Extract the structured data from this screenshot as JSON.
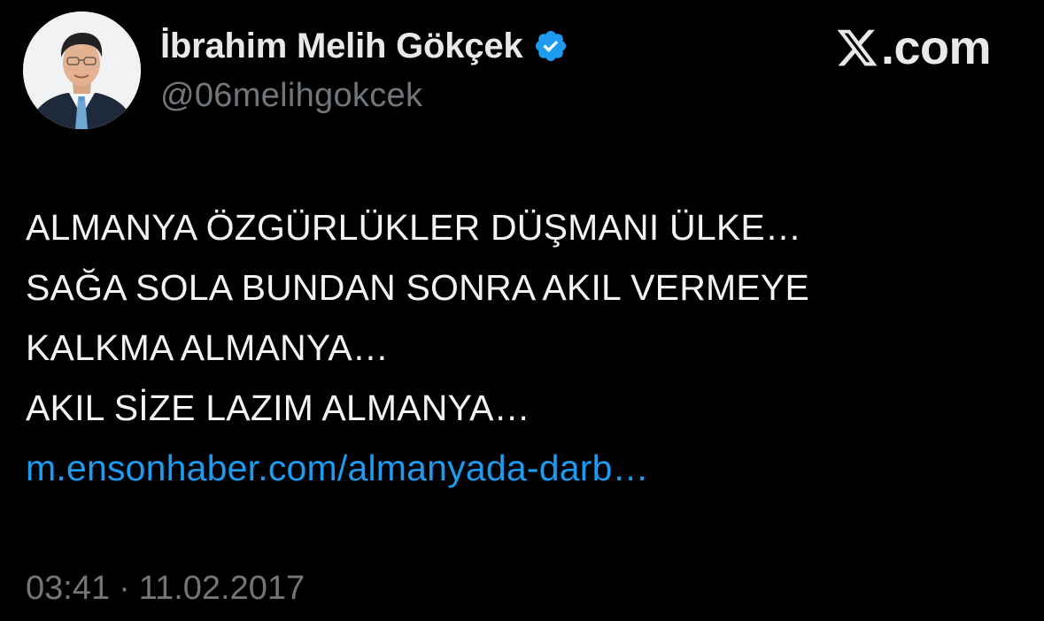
{
  "author": {
    "display_name": "İbrahim Melih Gökçek",
    "handle": "@06melihgokcek",
    "verified": true,
    "avatar_icon": "profile-photo"
  },
  "brand": {
    "logo_icon": "x-logo-icon",
    "suffix": ".com"
  },
  "tweet": {
    "lines": [
      "ALMANYA ÖZGÜRLÜKLER DÜŞMANI ÜLKE…",
      "SAĞA SOLA BUNDAN SONRA AKIL VERMEYE",
      "KALKMA ALMANYA…",
      "AKIL SİZE LAZIM ALMANYA…"
    ],
    "link_text": "m.ensonhaber.com/almanyada-darb…"
  },
  "meta": {
    "time": "03:41",
    "separator": "·",
    "date": "11.02.2017"
  },
  "colors": {
    "background": "#000000",
    "text": "#e7e9ea",
    "secondary": "#71767b",
    "link": "#1d9bf0",
    "verified_badge": "#1d9bf0"
  }
}
